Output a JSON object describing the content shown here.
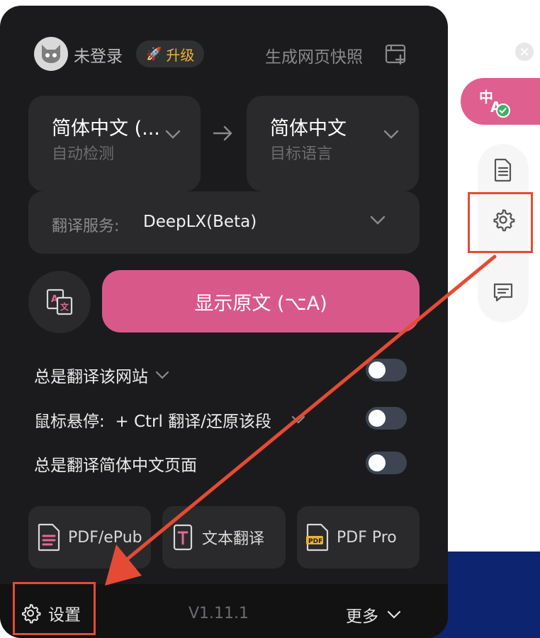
{
  "header": {
    "login_status": "未登录",
    "upgrade_label": "升级",
    "snapshot_label": "生成网页快照"
  },
  "language": {
    "source_main": "简体中文 (...",
    "source_sub": "自动检测",
    "target_main": "简体中文",
    "target_sub": "目标语言"
  },
  "service": {
    "label": "翻译服务:",
    "value": "DeepLX(Beta)"
  },
  "primary_action": {
    "label": "显示原文 (⌥A)"
  },
  "options": [
    {
      "label": "总是翻译该网站",
      "has_dropdown": true,
      "enabled": false
    },
    {
      "label": "鼠标悬停:  + Ctrl 翻译/还原该段",
      "has_dropdown": true,
      "enabled": false
    },
    {
      "label": "总是翻译简体中文页面",
      "has_dropdown": false,
      "enabled": false
    }
  ],
  "tools": [
    {
      "label": "PDF/ePub",
      "icon": "pdf-document-icon"
    },
    {
      "label": "文本翻译",
      "icon": "text-translate-icon"
    },
    {
      "label": "PDF Pro",
      "icon": "pdf-pro-icon"
    }
  ],
  "footer": {
    "settings_label": "设置",
    "version": "V1.11.1",
    "more_label": "更多"
  },
  "colors": {
    "panel_bg": "#1b1b1d",
    "accent_pink": "#d9588a",
    "upgrade_gold": "#eeb233",
    "annotation_red": "#e54b34"
  }
}
